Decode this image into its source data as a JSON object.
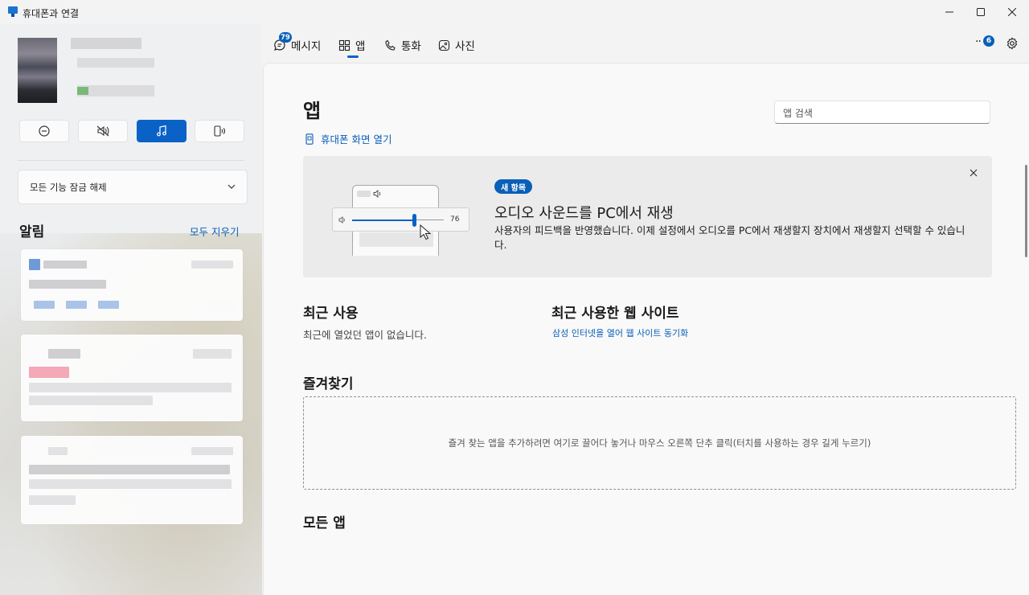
{
  "window": {
    "title": "휴대폰과 연결",
    "minimize_icon": "minimize-icon",
    "maximize_icon": "maximize-icon",
    "close_icon": "close-icon"
  },
  "sidebar": {
    "quick_actions": [
      {
        "name": "do-not-disturb",
        "icon": "minus-circle-icon",
        "active": false
      },
      {
        "name": "mute",
        "icon": "speaker-mute-icon",
        "active": false
      },
      {
        "name": "media",
        "icon": "music-note-icon",
        "active": true
      },
      {
        "name": "audio-to-pc",
        "icon": "phone-speaker-icon",
        "active": false
      }
    ],
    "unlock_label": "모든 기능 잠금 해제",
    "notifications_title": "알림",
    "clear_all": "모두 지우기"
  },
  "nav": {
    "tabs": [
      {
        "label": "메시지",
        "icon": "message-icon",
        "badge": "79"
      },
      {
        "label": "앱",
        "icon": "apps-grid-icon",
        "selected": true
      },
      {
        "label": "통화",
        "icon": "phone-icon"
      },
      {
        "label": "사진",
        "icon": "photo-icon"
      }
    ],
    "more_badge": "6",
    "settings_icon": "gear-icon"
  },
  "main": {
    "title": "앱",
    "search_placeholder": "앱 검색",
    "open_screen": "휴대폰 화면 열기",
    "banner": {
      "badge": "새 항목",
      "title": "오디오 사운드를 PC에서 재생",
      "description": "사용자의 피드백을 반영했습니다. 이제 설정에서 오디오를 PC에서 재생할지 장치에서 재생할지 선택할 수 있습니다.",
      "slider_value": "76"
    },
    "recent_title": "최근 사용",
    "recent_empty": "최근에 열었던 앱이 없습니다.",
    "recent_web_title": "최근 사용한 웹 사이트",
    "recent_web_link": "삼성 인터넷을 열어 웹 사이트 동기화",
    "favorites_title": "즐겨찾기",
    "favorites_hint": "즐겨 찾는 앱을 추가하려면 여기로 끌어다 놓거나 마우스 오른쪽 단추 클릭(터치를 사용하는 경우 길게 누르기)",
    "all_apps_title": "모든 앱"
  },
  "colors": {
    "accent": "#0a62c7",
    "link": "#0a5fb8",
    "background": "#f3f3f3"
  }
}
